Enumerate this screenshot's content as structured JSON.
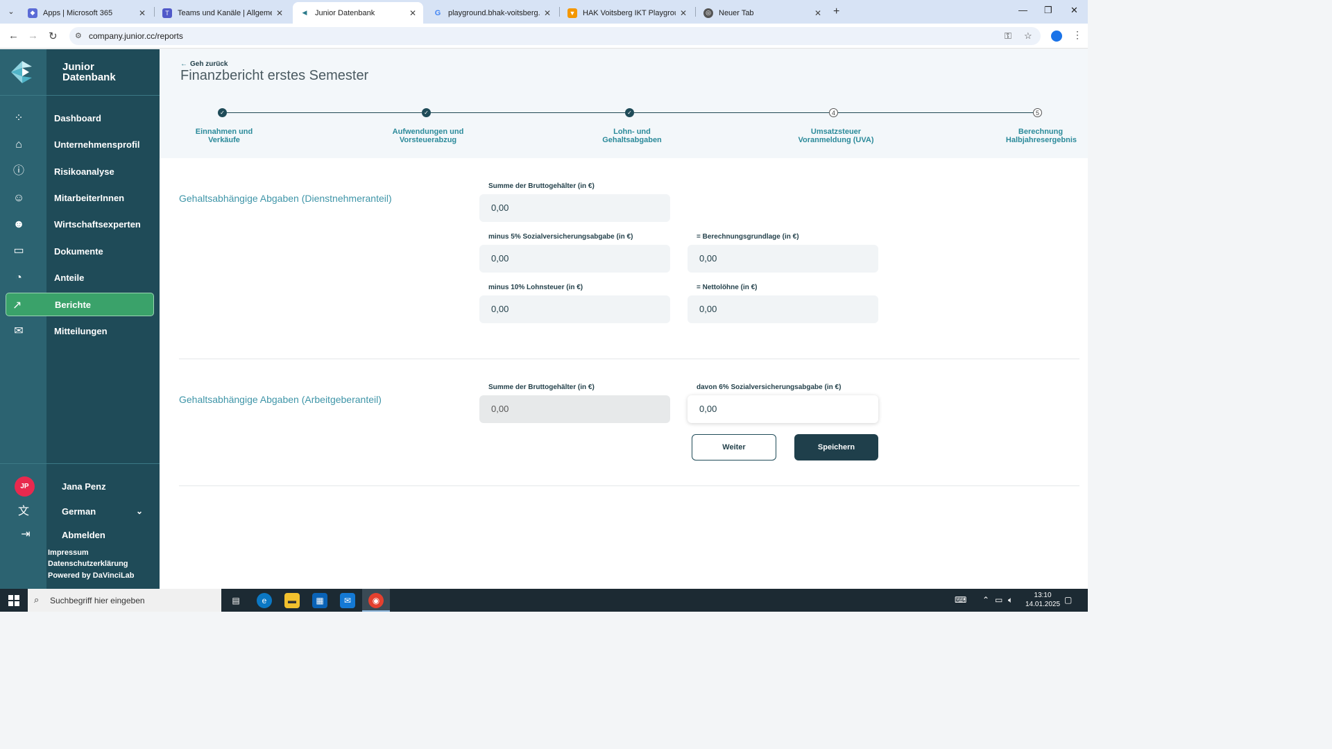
{
  "browser": {
    "tabs": [
      {
        "title": "Apps | Microsoft 365",
        "icon": "m365-icon"
      },
      {
        "title": "Teams und Kanäle | Allgemein |",
        "icon": "teams-icon"
      },
      {
        "title": "Junior Datenbank",
        "icon": "junior-icon",
        "active": true
      },
      {
        "title": "playground.bhak-voitsberg.at/",
        "icon": "google-icon"
      },
      {
        "title": "HAK Voitsberg IKT Playground",
        "icon": "typo3-icon"
      },
      {
        "title": "Neuer Tab",
        "icon": "chrome-icon"
      }
    ],
    "url": "company.junior.cc/reports"
  },
  "sidebar": {
    "brand_line1": "Junior",
    "brand_line2": "Datenbank",
    "items": [
      {
        "label": "Dashboard",
        "icon": "dashboard-icon"
      },
      {
        "label": "Unternehmensprofil",
        "icon": "company-icon"
      },
      {
        "label": "Risikoanalyse",
        "icon": "risk-icon"
      },
      {
        "label": "MitarbeiterInnen",
        "icon": "team-icon"
      },
      {
        "label": "Wirtschaftsexperten",
        "icon": "experts-icon"
      },
      {
        "label": "Dokumente",
        "icon": "folder-icon"
      },
      {
        "label": "Anteile",
        "icon": "pie-icon"
      },
      {
        "label": "Berichte",
        "icon": "chart-icon",
        "active": true
      },
      {
        "label": "Mitteilungen",
        "icon": "message-icon"
      }
    ],
    "user_initials": "JP",
    "user_name": "Jana Penz",
    "language": "German",
    "logout": "Abmelden",
    "footer": [
      "Impressum",
      "Datenschutzerklärung",
      "Powered by DaVinciLab"
    ]
  },
  "main": {
    "back_label": "Geh zurück",
    "title": "Finanzbericht erstes Semester",
    "steps": [
      {
        "label_line1": "Einnahmen und",
        "label_line2": "Verkäufe",
        "status": "done"
      },
      {
        "label_line1": "Aufwendungen und",
        "label_line2": "Vorsteuerabzug",
        "status": "done"
      },
      {
        "label_line1": "Lohn- und",
        "label_line2": "Gehaltsabgaben",
        "status": "done"
      },
      {
        "label_line1": "Umsatzsteuer",
        "label_line2": "Voranmeldung (UVA)",
        "status": "todo",
        "number": "4"
      },
      {
        "label_line1": "Berechnung",
        "label_line2": "Halbjahresergebnis",
        "status": "todo",
        "number": "5"
      }
    ],
    "section1": {
      "title": "Gehaltsabhängige Abgaben (Dienstnehmeranteil)",
      "brutto_label": "Summe der Bruttogehälter (in €)",
      "brutto_value": "0,00",
      "sv_label": "minus 5% Sozialversicherungsabgabe (in €)",
      "sv_value": "0,00",
      "basis_label": "= Berechnungsgrundlage (in €)",
      "basis_value": "0,00",
      "lohnsteuer_label": "minus 10% Lohnsteuer (in €)",
      "lohnsteuer_value": "0,00",
      "netto_label": "= Nettolöhne (in €)",
      "netto_value": "0,00"
    },
    "section2": {
      "title": "Gehaltsabhängige Abgaben (Arbeitgeberanteil)",
      "brutto_label": "Summe der Bruttogehälter (in €)",
      "brutto_value": "0,00",
      "sv_label": "davon 6% Sozialversicherungsabgabe (in €)",
      "sv_value": "0,00"
    },
    "buttons": {
      "next": "Weiter",
      "save": "Speichern"
    }
  },
  "taskbar": {
    "search_placeholder": "Suchbegriff hier eingeben",
    "time": "13:10",
    "date": "14.01.2025"
  }
}
